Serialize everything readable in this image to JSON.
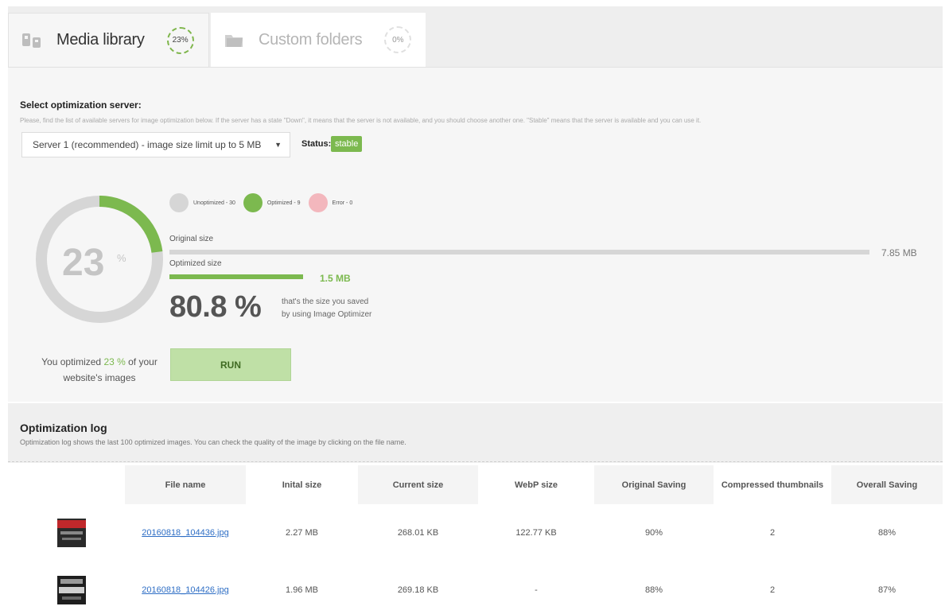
{
  "tabs": [
    {
      "label": "Media library",
      "badge": "23%"
    },
    {
      "label": "Custom folders",
      "badge": "0%"
    }
  ],
  "server": {
    "title": "Select optimization server:",
    "description": "Please, find the list of available servers for image optimization below. If the server has a state \"Down\", it means that the server is not available, and you should choose another one. \"Stable\" means that the server is available and you can use it.",
    "selected": "Server 1 (recommended) - image size limit up to 5 MB",
    "status_label": "Status:",
    "status_value": "stable"
  },
  "stats": {
    "percent": "23",
    "percent_symbol": "%",
    "percent_fraction": 0.23,
    "optimized_prefix": "You optimized ",
    "optimized_value": "23 %",
    "optimized_suffix": " of your",
    "optimized_line2": "website's images",
    "legend": [
      {
        "label": "Unoptimized - 30",
        "color": "#d6d6d6"
      },
      {
        "label": "Optimized - 9",
        "color": "#7cb94f"
      },
      {
        "label": "Error - 0",
        "color": "#f3b7bd"
      }
    ],
    "original_label": "Original size",
    "original_value": "7.85 MB",
    "optimized_label": "Optimized size",
    "optimized_size_value": "1.5 MB",
    "saved_percent": "80.8 %",
    "saved_line1": "that's the size you saved",
    "saved_line2": "by using Image Optimizer",
    "run_label": "RUN"
  },
  "log": {
    "title": "Optimization log",
    "description": "Optimization log shows the last 100 optimized images. You can check the quality of the image by clicking on the file name.",
    "columns": [
      "File name",
      "Inital size",
      "Current size",
      "WebP size",
      "Original Saving",
      "Compressed thumbnails",
      "Overall Saving"
    ],
    "rows": [
      {
        "file": "20160818_104436.jpg",
        "initial": "2.27 MB",
        "current": "268.01 KB",
        "webp": "122.77 KB",
        "original_saving": "90%",
        "thumbs": "2",
        "overall": "88%"
      },
      {
        "file": "20160818_104426.jpg",
        "initial": "1.96 MB",
        "current": "269.18 KB",
        "webp": "-",
        "original_saving": "88%",
        "thumbs": "2",
        "overall": "87%"
      }
    ]
  },
  "colors": {
    "accent": "#7cb94f",
    "bar_gray": "#d6d6d6",
    "link": "#2e6ec5"
  }
}
